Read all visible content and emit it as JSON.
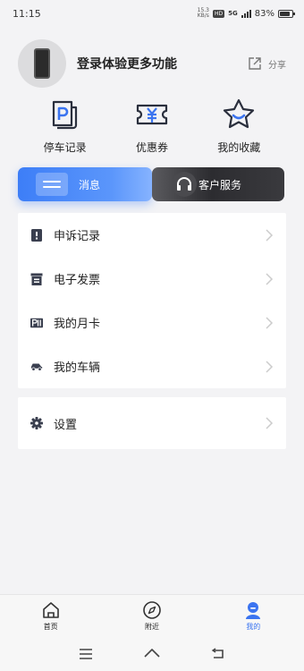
{
  "status_bar": {
    "time": "11:15",
    "net_speed_top": "15.3",
    "net_speed_bottom": "KB/s",
    "hd_badge": "HD",
    "network": "5G",
    "battery": "83%",
    "battery_level": 0.83
  },
  "profile": {
    "login_prompt": "登录体验更多功能",
    "share_label": "分享"
  },
  "quick_actions": [
    {
      "label": "停车记录",
      "icon": "parking-record-icon"
    },
    {
      "label": "优惠券",
      "icon": "coupon-icon"
    },
    {
      "label": "我的收藏",
      "icon": "star-favorite-icon"
    }
  ],
  "message_button": {
    "label": "消息"
  },
  "service_button": {
    "label": "客户服务"
  },
  "menu": [
    {
      "label": "申诉记录",
      "icon": "appeal-icon"
    },
    {
      "label": "电子发票",
      "icon": "invoice-icon"
    },
    {
      "label": "我的月卡",
      "icon": "monthly-card-icon"
    },
    {
      "label": "我的车辆",
      "icon": "car-icon"
    }
  ],
  "settings": {
    "label": "设置",
    "icon": "gear-icon"
  },
  "bottom_nav": [
    {
      "label": "首页",
      "icon": "home-icon",
      "active": false
    },
    {
      "label": "附近",
      "icon": "compass-icon",
      "active": false
    },
    {
      "label": "我的",
      "icon": "user-icon",
      "active": true
    }
  ],
  "colors": {
    "accent": "#3b74f0",
    "icon_dark": "#3a3f4f",
    "background": "#f3f3f5"
  }
}
